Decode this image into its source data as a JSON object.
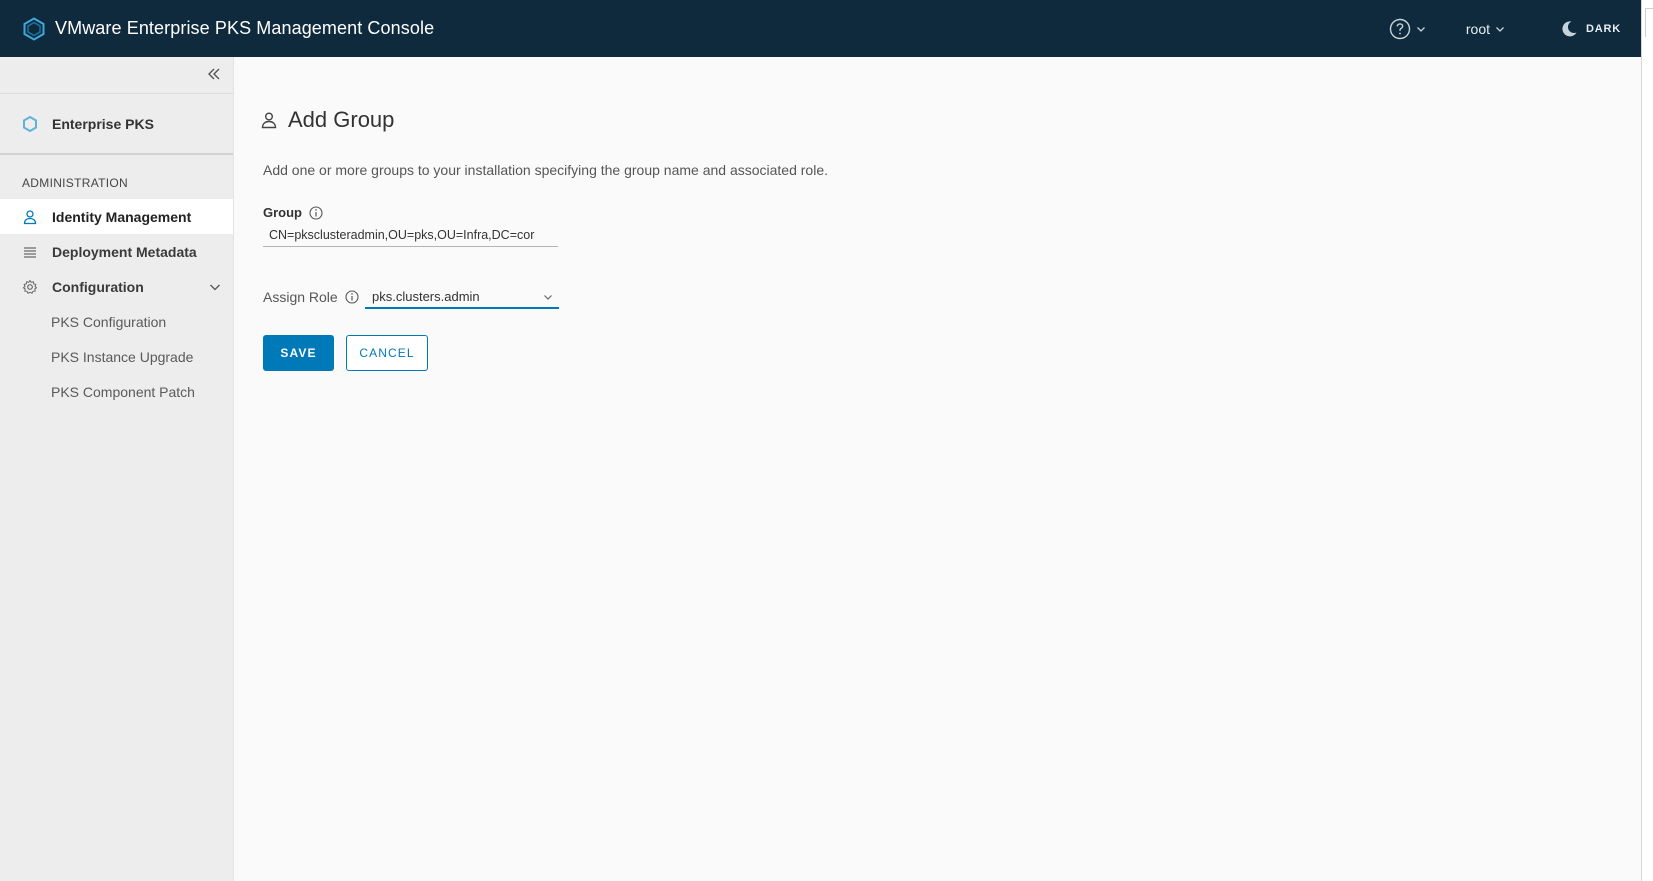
{
  "header": {
    "title": "VMware Enterprise PKS Management Console",
    "user": "root",
    "theme_label": "DARK",
    "logo_icon": "vmware-pks-logo-icon",
    "help_icon": "help-circle-icon"
  },
  "sidebar": {
    "product": "Enterprise PKS",
    "section_title": "ADMINISTRATION",
    "items": [
      {
        "label": "Identity Management",
        "icon": "user-icon",
        "active": true
      },
      {
        "label": "Deployment Metadata",
        "icon": "list-icon"
      },
      {
        "label": "Configuration",
        "icon": "gear-icon",
        "expanded": true
      }
    ],
    "sub_items": [
      {
        "label": "PKS Configuration"
      },
      {
        "label": "PKS Instance Upgrade"
      },
      {
        "label": "PKS Component Patch"
      }
    ]
  },
  "main": {
    "title": "Add Group",
    "description": "Add one or more groups to your installation specifying the group name and associated role.",
    "group_label": "Group",
    "group_value": "CN=pksclusteradmin,OU=pks,OU=Infra,DC=cor",
    "role_label": "Assign Role",
    "role_value": "pks.clusters.admin",
    "save_label": "SAVE",
    "cancel_label": "CANCEL"
  },
  "colors": {
    "header_bg": "#0f2a3d",
    "accent": "#0079b8",
    "sidebar_bg": "#ededed",
    "main_bg": "#fafafa"
  }
}
